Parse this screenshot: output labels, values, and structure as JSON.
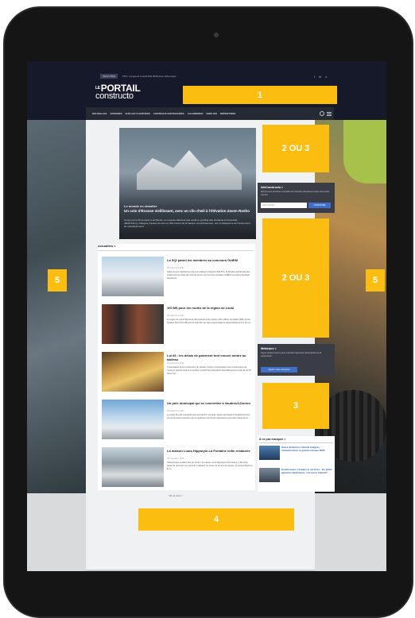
{
  "topbar": {
    "ticker_badge": "INDUSTRIE",
    "ticker_text": "PPU: Longueuil investit 600 000$ dans 100 projets",
    "social": [
      "f",
      "in",
      "x"
    ]
  },
  "logo": {
    "small": "LE",
    "line1": "PORTAIL",
    "line2": "constructo"
  },
  "zones": {
    "z1": "1",
    "z2a": "2 OU 3",
    "z2b": "2 OU 3",
    "z3": "3",
    "z4": "4",
    "z5_left": "5",
    "z5_right": "5"
  },
  "nav": [
    "NOUVELLES",
    "APPARIES",
    "SUR LES CHANTIERS",
    "CONTENUS PARTENAIRES",
    "CALENDRIER",
    "EMPLOIS",
    "RÉPERTOIRE"
  ],
  "hero": {
    "tag": "Le monde en chantier",
    "title": "Un coin d'Écosse vieillissant, avec un clin d'œil à l'élévation Zaven Rosho",
    "desc": "Conçu par la firme Gwin & architects, le nouveau bâtiment que verdit le syndicat des étudiants à l'université d'Edimbourg, Glasgow, hausse de sens et offre même de la hauteur de l'architecture, une conséquence de l'événement de refroidissement."
  },
  "news": {
    "heading": "Actualités >",
    "items": [
      {
        "title": "La SQI parmi les membres au concours GetEM",
        "date": "08 septembre 2022",
        "excerpt": "Grâce au bon déploiement de ses pratiques intégrées (MA-PC), la Société québécoise des infrastructures (SQI) de retrouve de lien du concours canadien GetEM Innovation Spotlight Awards (G..."
      },
      {
        "title": "100 M$ pour les routes de la région de Laval",
        "date": "08 septembre 2022",
        "excerpt": "La région de Laval disposera d'investissements routiers 100 millions de dollars (M$) par les Québec Dont 62,5 M$ pour la réduction de sept projets majeurs d'agrandissement et de voi..."
      },
      {
        "title": "Loi 66 : les délais de paiement font encore ombre au tableau",
        "date": "08 septembre 2022",
        "excerpt": "L'Association de la construction du Québec (ACQ) et l'Association des constructeurs de routes et grands travaux du Québec (ACRGTQ) accueillent favorablement le projet de loi 66. Nous croi..."
      },
      {
        "title": "Un pôle municipal qui se concrétise à Vaudreuil-Dorion",
        "date": "08 septembre 2022",
        "excerpt": "Le projet de pôle municipal vient de franchir une autre étape importante à Vaudreuil-Dorion, un permis étant présenté pour le règlement d'emprunt autorisant la première phase de la..."
      },
      {
        "title": "La maison Louis-Hippolyte-La Fontaine enfin restaurée",
        "date": "08 septembre 2022",
        "excerpt": "Abandonnée pendant plus de 15 ans, la maison Louis-Hippolyte-La Fontaine, a fait enfin l'objet de retrouver ses vitres de noblesse. Au terme de 10 ans de travaux, le Groupe Mach et le Lo..."
      }
    ],
    "see_all": "Voir la suite >"
  },
  "newsletter": {
    "title": "InfoConstructo >",
    "desc": "Recevez les dernières nouvelles de l'industrie directement dans votre boîte courriel",
    "placeholder": "Votre courriel",
    "button": "S'INSCRIRE"
  },
  "event": {
    "title": "Webinaire >",
    "desc": "Soyez présent avec le plus important répertoire d'entreprises de la construction",
    "button": "Ajouter votre entreprise"
  },
  "missed": {
    "heading": "À ne pas manquer >",
    "items": [
      {
        "title": "Gérez durant les robuste intégrés : infrastructures et grands travaux 2020"
      },
      {
        "title": "Soumissions, réseaux et services : les poids apportés électriques, c'est pour bientôt?"
      }
    ]
  },
  "colors": {
    "zone": "#fbbd0f",
    "topbar": "#16192a",
    "link": "#2c5aa0"
  }
}
